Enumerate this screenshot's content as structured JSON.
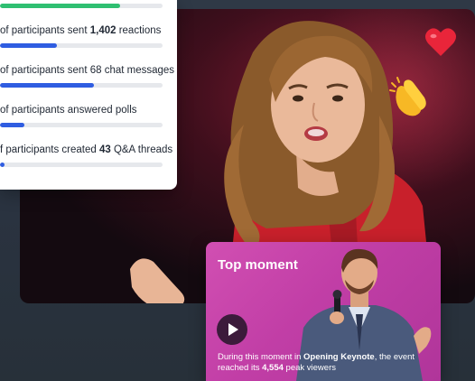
{
  "stats": [
    {
      "prefix": "of participants sent ",
      "bold": "1,402",
      "suffix": " reactions",
      "fill": 0.35,
      "color": "#2f5de1"
    },
    {
      "prefix": "of participants sent 68 chat messages",
      "bold": "",
      "suffix": "",
      "fill": 0.58,
      "color": "#2f5de1"
    },
    {
      "prefix": "of participants answered polls",
      "bold": "",
      "suffix": "",
      "fill": 0.15,
      "color": "#2f5de1"
    },
    {
      "prefix": "f participants created ",
      "bold": "43",
      "suffix": " Q&A threads",
      "fill": 0.03,
      "color": "#2f5de1"
    }
  ],
  "top_stat_fill": {
    "fill": 0.74,
    "color": "#2fbf71"
  },
  "reactions": [
    {
      "icon": "heart-icon"
    },
    {
      "icon": "clapping-hands-icon"
    }
  ],
  "top_moment": {
    "title": "Top moment",
    "caption_prefix": "During this moment in ",
    "session": "Opening Keynote",
    "caption_middle": ", the event reached its ",
    "peak": "4,554",
    "caption_suffix": " peak viewers"
  },
  "colors": {
    "accent_blue": "#2f5de1",
    "accent_green": "#2fbf71",
    "moment_pink": "#c13ea6"
  }
}
